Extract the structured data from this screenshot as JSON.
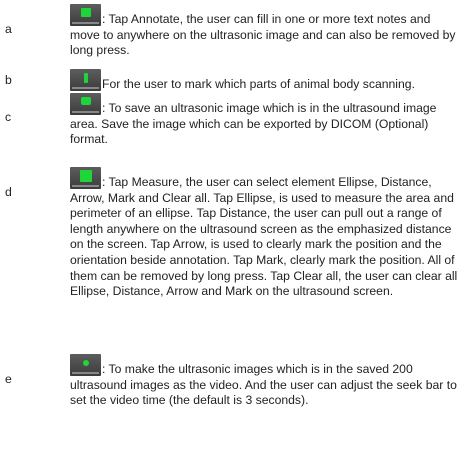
{
  "items": [
    {
      "letter": "a",
      "icon": "annotate-icon",
      "text": ": Tap Annotate, the user can fill in one or more text notes and move to anywhere on the ultrasonic image and can also be removed by long press."
    },
    {
      "letter": "b",
      "icon": "body-mark-icon",
      "text": "For the user to mark which parts of animal body scanning."
    },
    {
      "letter": "c",
      "icon": "save-image-icon",
      "text": ": To save an ultrasonic image which is in the ultrasound image area. Save the image which can be exported by DICOM (Optional) format."
    },
    {
      "letter": "d",
      "icon": "measure-icon",
      "text": ": Tap Measure, the user can select element Ellipse, Distance, Arrow, Mark and Clear all. Tap Ellipse, is used to measure the area and perimeter of an ellipse. Tap Distance, the user can pull out a range of length anywhere on the ultrasound screen as the emphasized distance on the screen. Tap Arrow, is used to clearly mark the position and the orientation beside annotation. Tap Mark, clearly mark the position. All of them can be removed by long press. Tap Clear all, the user can clear all Ellipse, Distance, Arrow and Mark on the ultrasound screen."
    },
    {
      "letter": "e",
      "icon": "save-video-icon",
      "text": ": To make the ultrasonic images which is in the saved 200 ultrasound images as the video. And the user can adjust the seek bar to set the video time (the default is 3 seconds)."
    }
  ]
}
